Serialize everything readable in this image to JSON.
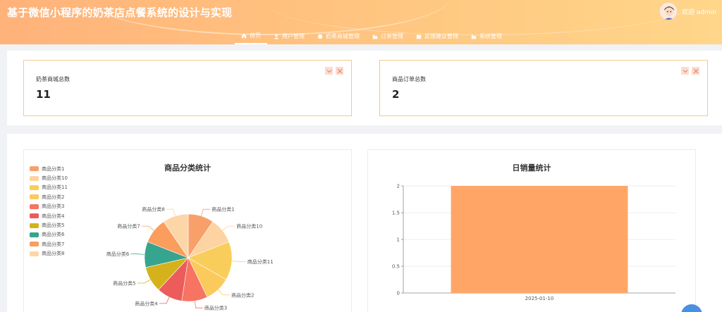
{
  "header": {
    "title": "基于微信小程序的奶茶店点餐系统的设计与实现",
    "greeting": "欢迎 admin",
    "nav": [
      {
        "label": "首页",
        "icon": "home-icon",
        "active": true
      },
      {
        "label": "用户管理",
        "icon": "user-icon",
        "active": false
      },
      {
        "label": "奶茶商城管理",
        "icon": "shop-icon",
        "active": false
      },
      {
        "label": "订单管理",
        "icon": "order-icon",
        "active": false
      },
      {
        "label": "反馈建议管理",
        "icon": "feedback-icon",
        "active": false
      },
      {
        "label": "系统管理",
        "icon": "system-icon",
        "active": false
      }
    ]
  },
  "stats": [
    {
      "label": "奶茶商城总数",
      "value": "11"
    },
    {
      "label": "商品订单总数",
      "value": "2"
    }
  ],
  "colors": {
    "accent": "#ffa96a",
    "card_border": "#f2c98e"
  },
  "chart_data": [
    {
      "type": "pie",
      "title": "商品分类统计",
      "legend_position": "top-left",
      "categories": [
        "商品分类1",
        "商品分类10",
        "商品分类11",
        "商品分类2",
        "商品分类3",
        "商品分类4",
        "商品分类5",
        "商品分类6",
        "商品分类7",
        "商品分类8"
      ],
      "values": [
        1,
        1,
        1.5,
        1,
        1,
        1,
        1,
        1,
        1,
        1
      ],
      "colors": [
        "#f9a06a",
        "#fdd3a2",
        "#f9cd5b",
        "#fcca5c",
        "#f77462",
        "#eb5c5a",
        "#d5b21c",
        "#36a48e",
        "#fb9d5d",
        "#fdd6a8"
      ]
    },
    {
      "type": "bar",
      "title": "日销量统计",
      "categories": [
        "2025-01-10"
      ],
      "values": [
        2
      ],
      "ylim": [
        0,
        2
      ],
      "yticks": [
        "0",
        "0.5",
        "1",
        "1.5",
        "2"
      ],
      "color": "#ffa667",
      "grid": true
    }
  ]
}
